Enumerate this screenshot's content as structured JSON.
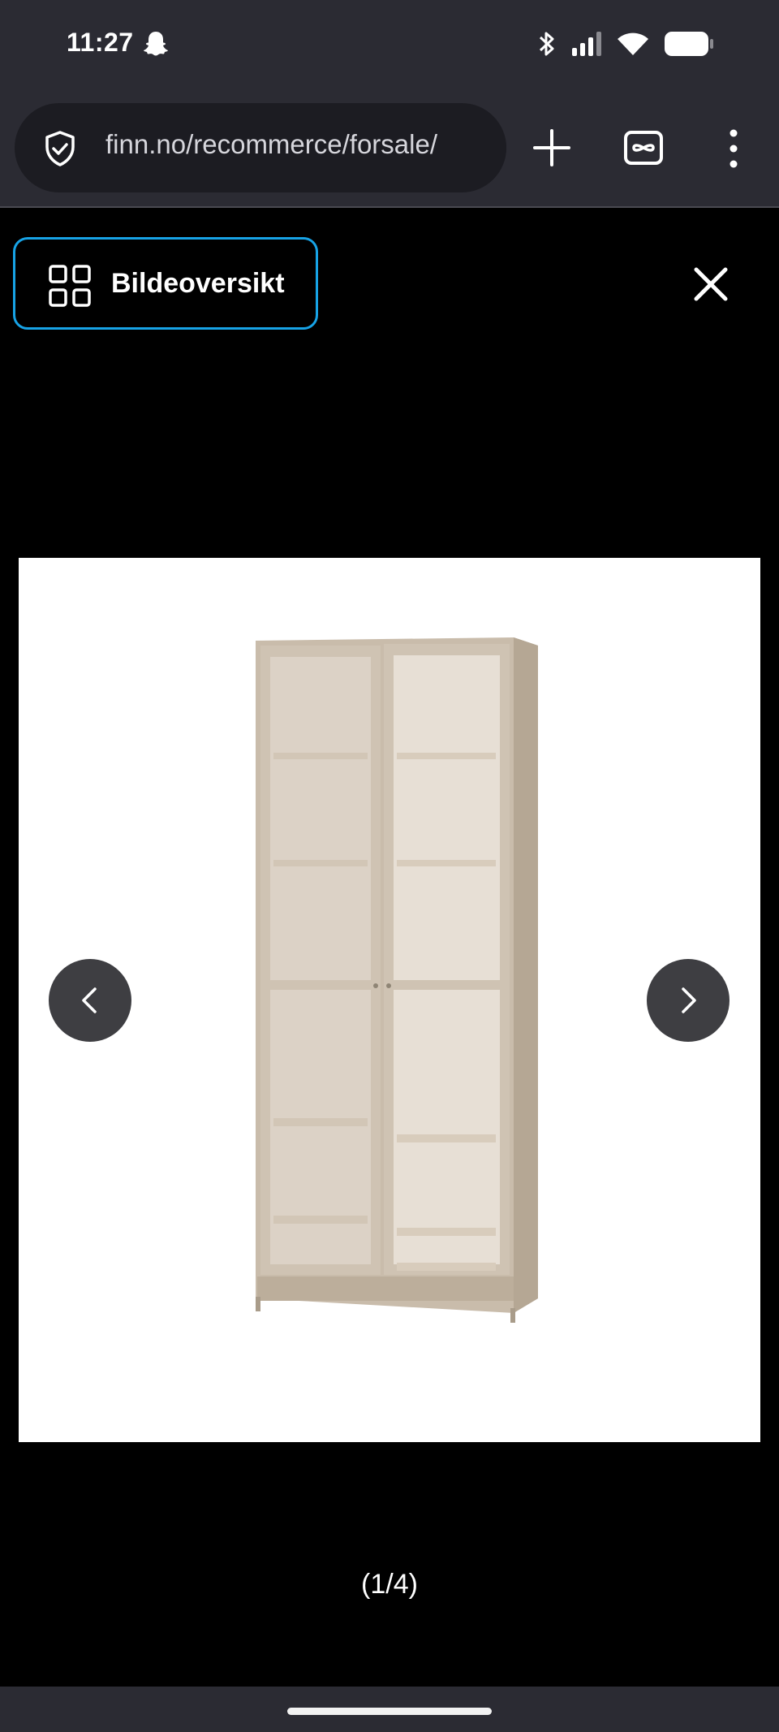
{
  "status_bar": {
    "time": "11:27",
    "icons": [
      "snapchat-icon",
      "bluetooth-icon",
      "signal-icon",
      "wifi-icon",
      "battery-icon"
    ]
  },
  "browser": {
    "url": "finn.no/recommerce/forsale/",
    "icons": [
      "shield-check-icon",
      "plus-icon",
      "incognito-tabs-icon",
      "overflow-menu-icon"
    ]
  },
  "viewer": {
    "overview_label": "Bildeoversikt",
    "counter": "(1/4)",
    "image_alt": "Glass-door bookcase",
    "colors": {
      "accent_border": "#17a3e6",
      "background": "#000000",
      "nav_button": "#3e3e42"
    }
  }
}
